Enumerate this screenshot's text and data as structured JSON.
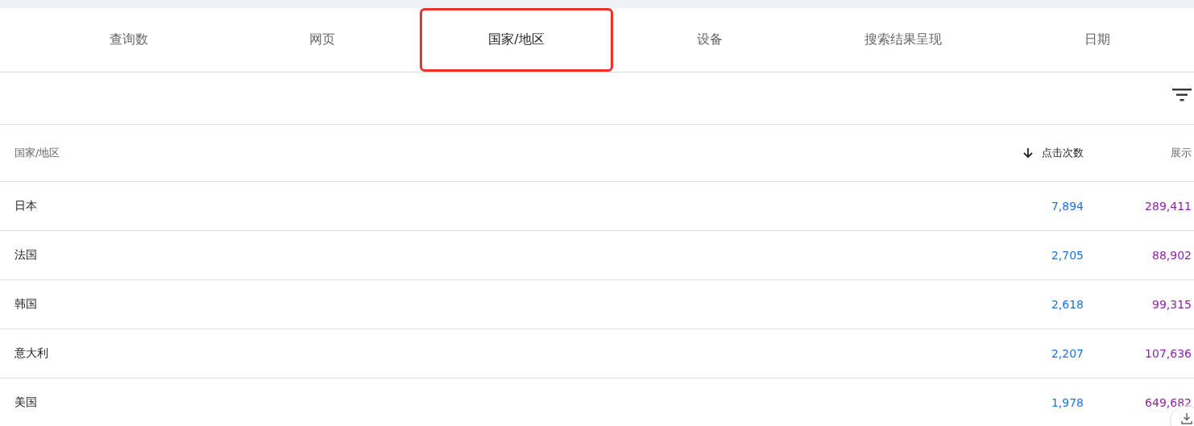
{
  "tabs": [
    {
      "label": "查询数",
      "selected": false
    },
    {
      "label": "网页",
      "selected": false
    },
    {
      "label": "国家/地区",
      "selected": true
    },
    {
      "label": "设备",
      "selected": false
    },
    {
      "label": "搜索结果呈现",
      "selected": false
    },
    {
      "label": "日期",
      "selected": false
    }
  ],
  "table": {
    "columns": [
      {
        "label": "国家/地区",
        "sorted": false
      },
      {
        "label": "点击次数",
        "sorted": true
      },
      {
        "label": "展示",
        "sorted": false
      }
    ],
    "rows": [
      {
        "country": "日本",
        "clicks": "7,894",
        "impressions": "289,411"
      },
      {
        "country": "法国",
        "clicks": "2,705",
        "impressions": "88,902"
      },
      {
        "country": "韩国",
        "clicks": "2,618",
        "impressions": "99,315"
      },
      {
        "country": "意大利",
        "clicks": "2,207",
        "impressions": "107,636"
      },
      {
        "country": "美国",
        "clicks": "1,978",
        "impressions": "649,682"
      }
    ]
  }
}
